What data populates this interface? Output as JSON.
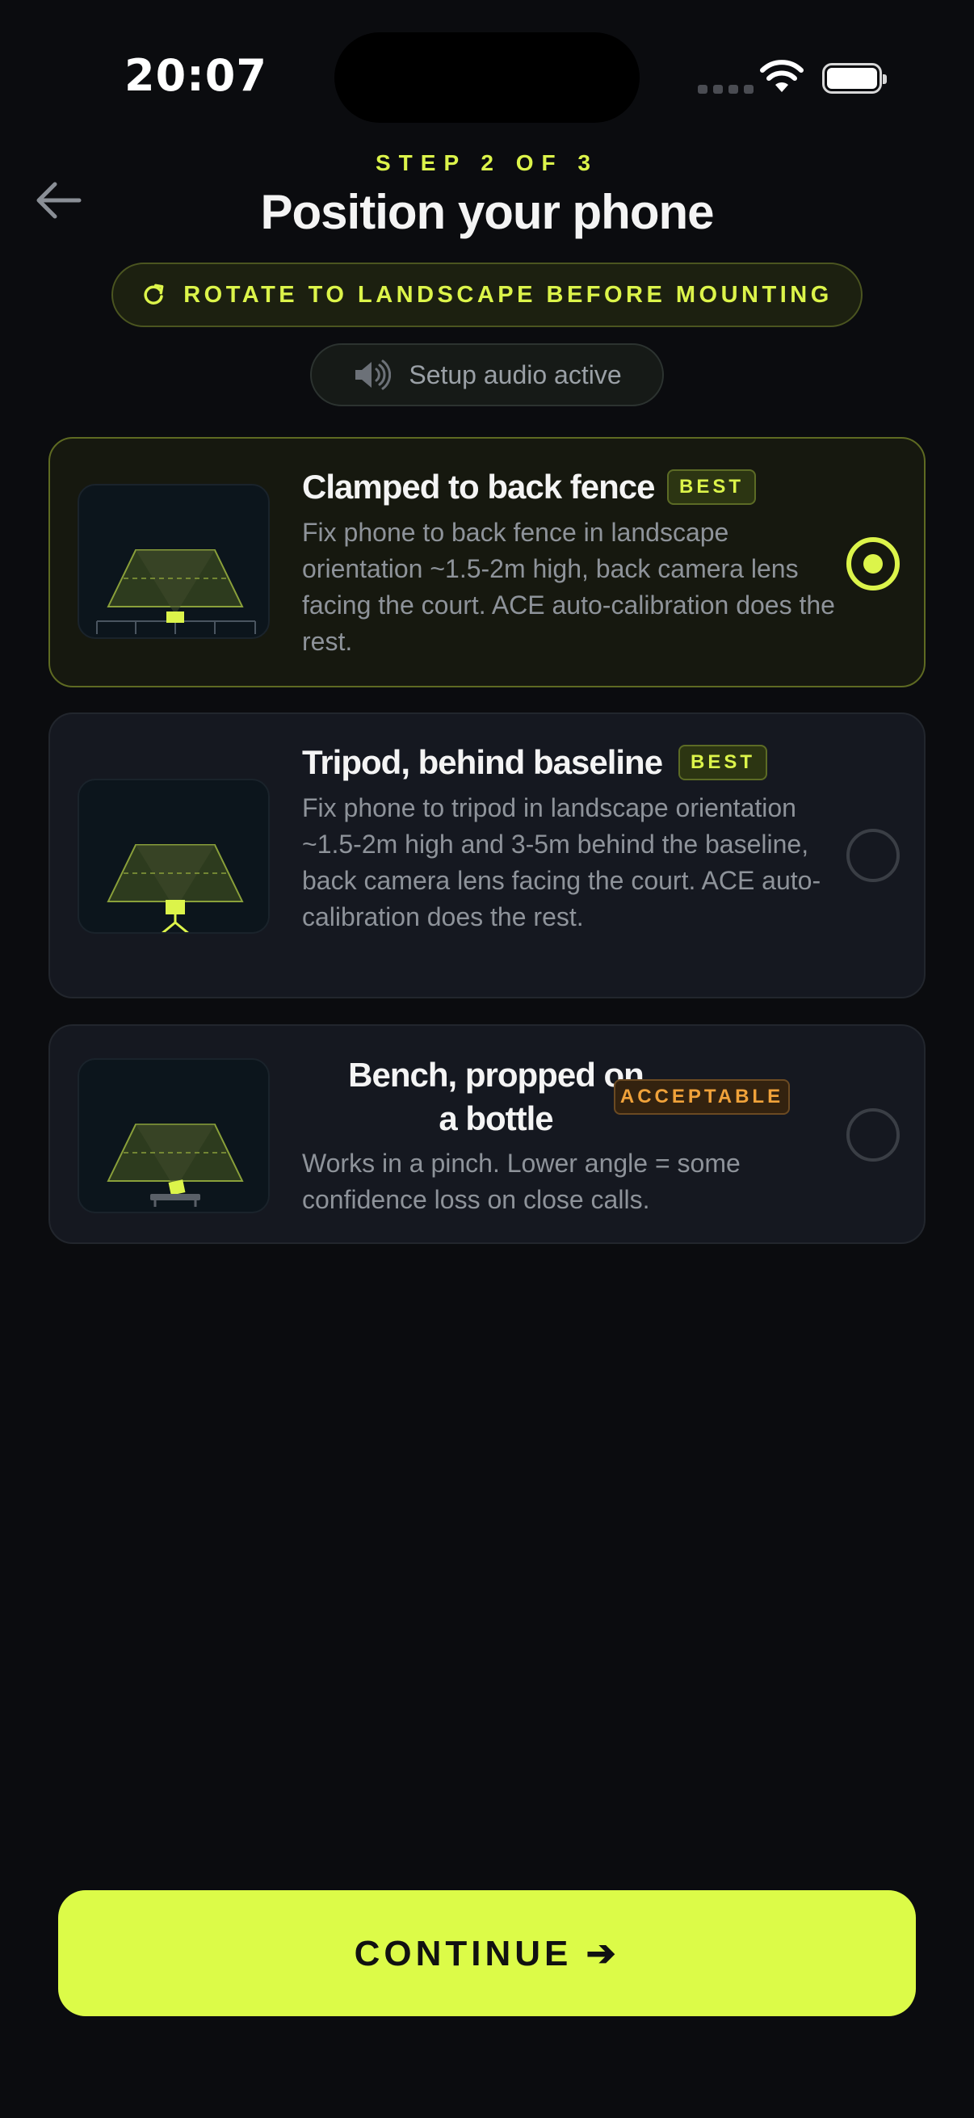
{
  "status_bar": {
    "time": "20:07"
  },
  "header": {
    "back_icon": "arrow-left-icon",
    "step": "STEP 2 OF 3",
    "title": "Position your phone",
    "rotate_notice": "ROTATE TO LANDSCAPE BEFORE MOUNTING",
    "rotate_icon": "rotate-icon",
    "audio_status": "Setup audio active",
    "audio_icon": "speaker-icon"
  },
  "options": [
    {
      "title": "Clamped to back fence",
      "badge": "BEST",
      "description": "Fix phone to back fence in landscape orientation ~1.5-2m high, back camera lens facing the court. ACE auto-calibration does the rest.",
      "selected": true,
      "illustration": "fence-mount-icon"
    },
    {
      "title": "Tripod, behind baseline",
      "badge": "BEST",
      "description": "Fix phone to tripod in landscape orientation ~1.5-2m high and 3-5m behind the baseline, back camera lens facing the court. ACE auto-calibration does the rest.",
      "selected": false,
      "illustration": "tripod-mount-icon"
    },
    {
      "title_line1": "Bench, propped on",
      "title_line2": "a bottle",
      "badge": "ACCEPTABLE",
      "description": "Works in a pinch. Lower angle = some confidence loss on close calls.",
      "selected": false,
      "illustration": "bench-mount-icon"
    }
  ],
  "footer": {
    "continue_label": "CONTINUE ➔"
  },
  "colors": {
    "accent": "#dcfb48",
    "background": "#0b0c0f",
    "card": "#151820",
    "acceptable": "#f0a23a"
  }
}
